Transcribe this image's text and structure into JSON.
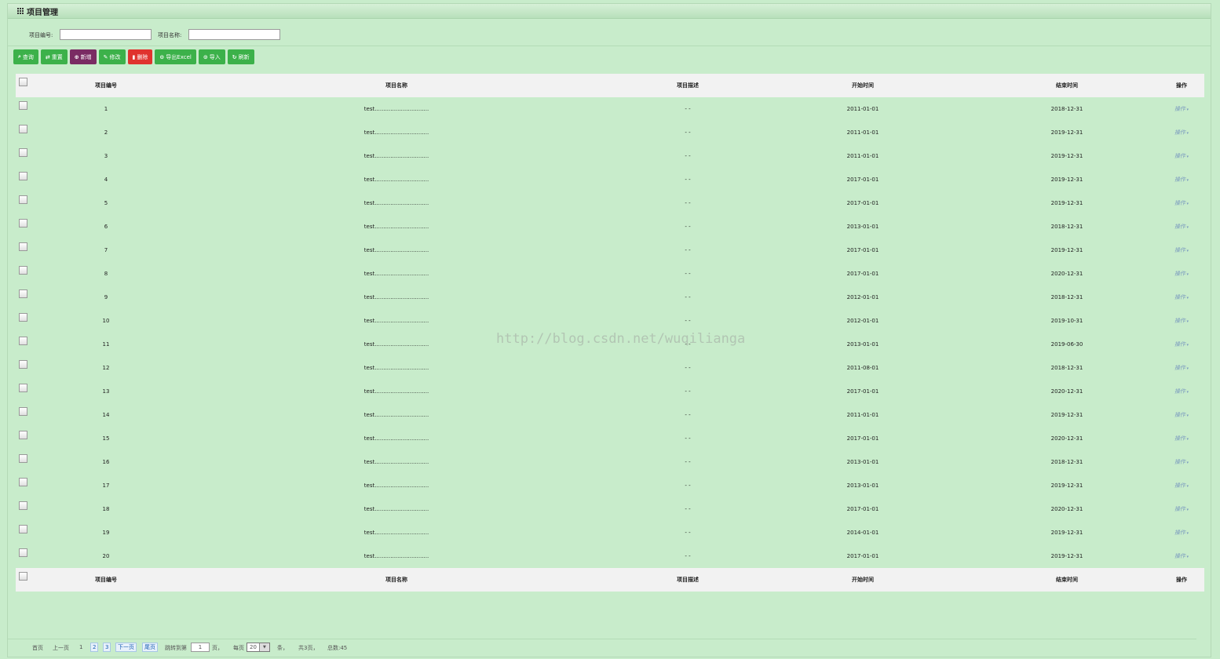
{
  "panel": {
    "title": "项目管理"
  },
  "search": {
    "project_no_label": "项目编号:",
    "project_no_value": "",
    "project_name_label": "项目名称:",
    "project_name_value": ""
  },
  "toolbar": {
    "query": "查询",
    "reset": "重置",
    "add": "新增",
    "edit": "修改",
    "delete": "删除",
    "export": "导出Excel",
    "import": "导入",
    "refresh": "刷新"
  },
  "colors": {
    "background": "#c8eccb",
    "green_button": "#3cb14a",
    "purple_button": "#7a2b63",
    "red_button": "#e0332e",
    "header_row": "#f2f2f2",
    "link": "#7a9abf"
  },
  "table": {
    "headers": {
      "no": "项目编号",
      "name": "项目名称",
      "desc": "项目描述",
      "start": "开始时间",
      "end": "结束时间",
      "op": "操作"
    },
    "rows": [
      {
        "no": "1",
        "name": "test...............................",
        "desc": "- -",
        "start": "2011-01-01",
        "end": "2018-12-31",
        "op": "操作"
      },
      {
        "no": "2",
        "name": "test...............................",
        "desc": "- -",
        "start": "2011-01-01",
        "end": "2019-12-31",
        "op": "操作"
      },
      {
        "no": "3",
        "name": "test...............................",
        "desc": "- -",
        "start": "2011-01-01",
        "end": "2019-12-31",
        "op": "操作"
      },
      {
        "no": "4",
        "name": "test...............................",
        "desc": "- -",
        "start": "2017-01-01",
        "end": "2019-12-31",
        "op": "操作"
      },
      {
        "no": "5",
        "name": "test...............................",
        "desc": "- -",
        "start": "2017-01-01",
        "end": "2019-12-31",
        "op": "操作"
      },
      {
        "no": "6",
        "name": "test...............................",
        "desc": "- -",
        "start": "2013-01-01",
        "end": "2018-12-31",
        "op": "操作"
      },
      {
        "no": "7",
        "name": "test...............................",
        "desc": "- -",
        "start": "2017-01-01",
        "end": "2019-12-31",
        "op": "操作"
      },
      {
        "no": "8",
        "name": "test...............................",
        "desc": "- -",
        "start": "2017-01-01",
        "end": "2020-12-31",
        "op": "操作"
      },
      {
        "no": "9",
        "name": "test...............................",
        "desc": "- -",
        "start": "2012-01-01",
        "end": "2018-12-31",
        "op": "操作"
      },
      {
        "no": "10",
        "name": "test...............................",
        "desc": "- -",
        "start": "2012-01-01",
        "end": "2019-10-31",
        "op": "操作"
      },
      {
        "no": "11",
        "name": "test...............................",
        "desc": "- -",
        "start": "2013-01-01",
        "end": "2019-06-30",
        "op": "操作"
      },
      {
        "no": "12",
        "name": "test...............................",
        "desc": "- -",
        "start": "2011-08-01",
        "end": "2018-12-31",
        "op": "操作"
      },
      {
        "no": "13",
        "name": "test...............................",
        "desc": "- -",
        "start": "2017-01-01",
        "end": "2020-12-31",
        "op": "操作"
      },
      {
        "no": "14",
        "name": "test...............................",
        "desc": "- -",
        "start": "2011-01-01",
        "end": "2019-12-31",
        "op": "操作"
      },
      {
        "no": "15",
        "name": "test...............................",
        "desc": "- -",
        "start": "2017-01-01",
        "end": "2020-12-31",
        "op": "操作"
      },
      {
        "no": "16",
        "name": "test...............................",
        "desc": "- -",
        "start": "2013-01-01",
        "end": "2018-12-31",
        "op": "操作"
      },
      {
        "no": "17",
        "name": "test...............................",
        "desc": "- -",
        "start": "2013-01-01",
        "end": "2019-12-31",
        "op": "操作"
      },
      {
        "no": "18",
        "name": "test...............................",
        "desc": "- -",
        "start": "2017-01-01",
        "end": "2020-12-31",
        "op": "操作"
      },
      {
        "no": "19",
        "name": "test...............................",
        "desc": "- -",
        "start": "2014-01-01",
        "end": "2019-12-31",
        "op": "操作"
      },
      {
        "no": "20",
        "name": "test...............................",
        "desc": "- -",
        "start": "2017-01-01",
        "end": "2019-12-31",
        "op": "操作"
      }
    ]
  },
  "watermark": "http://blog.csdn.net/wuqiliangа",
  "pager": {
    "first": "首页",
    "prev": "上一页",
    "pages": [
      "1",
      "2",
      "3"
    ],
    "next": "下一页",
    "last": "尾页",
    "jump_label": "跳转到第",
    "jump_value": "1",
    "page_unit": "页，",
    "per_page_label": "每页",
    "per_page_value": "20",
    "per_page_unit": "条，",
    "total_pages": "共3页，",
    "total_count": "总数:45"
  }
}
